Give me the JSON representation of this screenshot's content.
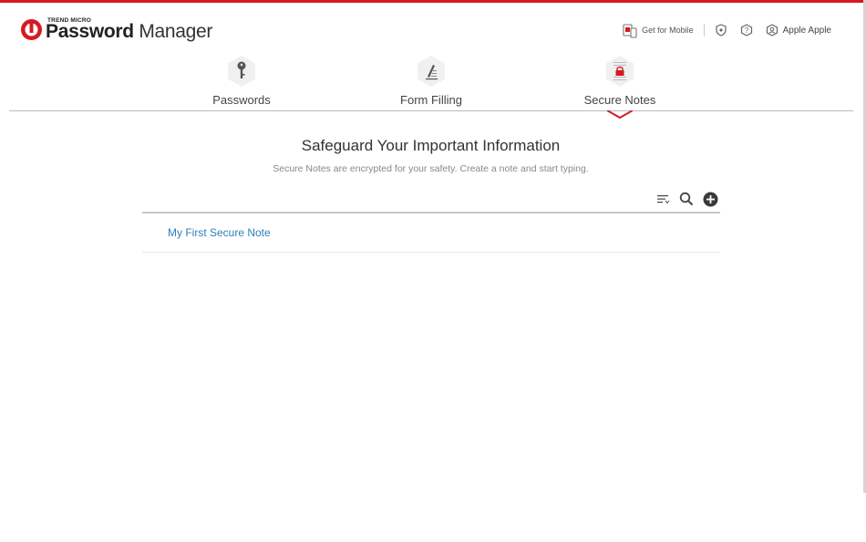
{
  "brand": {
    "company": "TREND MICRO",
    "product_bold": "Password",
    "product_thin": " Manager",
    "accent_color": "#d71921"
  },
  "header": {
    "mobile_label": "Get for Mobile",
    "mobile_icon": "mobile-devices-icon",
    "shield_icon": "shield-icon",
    "help_icon": "help-icon",
    "user_icon": "user-icon",
    "user_name": "Apple Apple"
  },
  "tabs": [
    {
      "label": "Passwords",
      "icon": "key-icon",
      "active": false
    },
    {
      "label": "Form Filling",
      "icon": "pen-icon",
      "active": false
    },
    {
      "label": "Secure Notes",
      "icon": "lock-note-icon",
      "active": true
    }
  ],
  "main": {
    "title": "Safeguard Your Important Information",
    "subtitle": "Secure Notes are encrypted for your safety. Create a note and start typing.",
    "toolbar": {
      "sort_icon": "sort-icon",
      "search_icon": "search-icon",
      "add_icon": "add-icon"
    },
    "notes": [
      {
        "title": "My First Secure Note"
      }
    ]
  }
}
